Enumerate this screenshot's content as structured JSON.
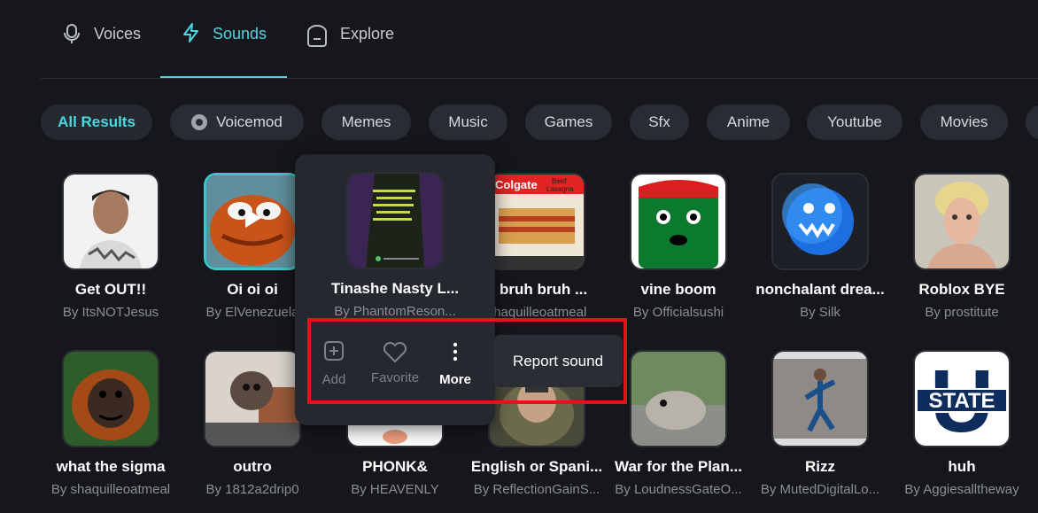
{
  "tabs": [
    {
      "label": "Voices",
      "icon": "microphone-icon",
      "active": false
    },
    {
      "label": "Sounds",
      "icon": "lightning-icon",
      "active": true
    },
    {
      "label": "Explore",
      "icon": "bag-icon",
      "active": false
    }
  ],
  "filters": [
    "All Results",
    "Voicemod",
    "Memes",
    "Music",
    "Games",
    "Sfx",
    "Anime",
    "Youtube",
    "Movies"
  ],
  "sounds": [
    {
      "title": "Get OUT!!",
      "author": "By ItsNOTJesus"
    },
    {
      "title": "Oi oi oi",
      "author": "By ElVenezuela"
    },
    {
      "title": "Tinashe Nasty L...",
      "author": "By PhantomReson..."
    },
    {
      "title": "h bruh bruh ...",
      "author": "shaquilleoatmeal"
    },
    {
      "title": "vine boom",
      "author": "By Officialsushi"
    },
    {
      "title": "nonchalant drea...",
      "author": "By Silk"
    },
    {
      "title": "Roblox BYE",
      "author": "By prostitute"
    },
    {
      "title": "what the sigma",
      "author": "By shaquilleoatmeal"
    },
    {
      "title": "outro",
      "author": "By 1812a2drip0"
    },
    {
      "title": "PHONK&",
      "author": "By HEAVENLY"
    },
    {
      "title": "English or Spani...",
      "author": "By ReflectionGainS..."
    },
    {
      "title": "War for the Plan...",
      "author": "By LoudnessGateO..."
    },
    {
      "title": "Rizz",
      "author": "By MutedDigitalLo..."
    },
    {
      "title": "huh",
      "author": "By Aggiesalltheway"
    }
  ],
  "thumb_text": {
    "colgate": "Colgate",
    "beef": "Beef",
    "lasagna": "Lasagna",
    "state": "STATE",
    "u": "U"
  },
  "context_menu": {
    "add_label": "Add",
    "favorite_label": "Favorite",
    "more_label": "More",
    "report_label": "Report sound"
  },
  "colors": {
    "accent": "#4dd6e0",
    "background": "#16171c",
    "highlight": "#e0141a"
  }
}
